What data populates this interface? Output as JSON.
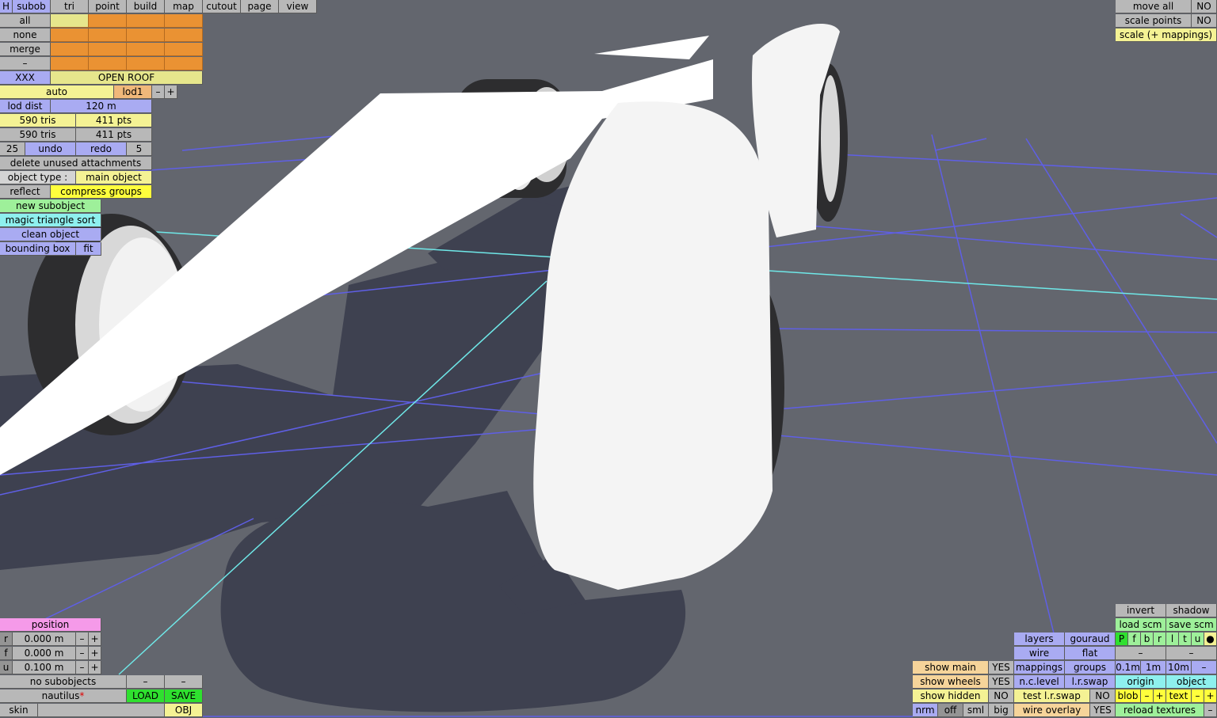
{
  "menu": {
    "h": "H",
    "tabs": [
      "subob",
      "tri",
      "point",
      "build",
      "map",
      "cutout",
      "page",
      "view"
    ]
  },
  "selection": {
    "all": "all",
    "none": "none",
    "merge": "merge",
    "minus": "–",
    "xxx": "XXX",
    "open_roof": "OPEN ROOF"
  },
  "lod": {
    "auto": "auto",
    "lod1": "lod1",
    "minus": "–",
    "plus": "+",
    "lod_dist_label": "lod dist",
    "lod_dist_value": "120 m"
  },
  "stats": {
    "tris1": "590 tris",
    "pts1": "411 pts",
    "tris2": "590 tris",
    "pts2": "411 pts"
  },
  "undo": {
    "count": "25",
    "undo": "undo",
    "redo": "redo",
    "redo_count": "5"
  },
  "actions": {
    "delete_unused": "delete unused attachments",
    "object_type_label": "object type :",
    "object_type_value": "main object",
    "reflect": "reflect",
    "compress_groups": "compress groups",
    "new_subobject": "new subobject",
    "magic_sort": "magic triangle sort",
    "clean_object": "clean object",
    "bounding_box": "bounding box",
    "fit": "fit"
  },
  "top_right": {
    "move_all": "move all",
    "move_all_val": "NO",
    "scale_points": "scale points",
    "scale_points_val": "NO",
    "scale_mappings": "scale (+ mappings)"
  },
  "position": {
    "title": "position",
    "rows": [
      {
        "axis": "r",
        "value": "0.000 m"
      },
      {
        "axis": "f",
        "value": "0.000 m"
      },
      {
        "axis": "u",
        "value": "0.100 m"
      }
    ],
    "minus": "–",
    "plus": "+"
  },
  "bottom_left": {
    "no_subobjects": "no subobjects",
    "dash": "–",
    "name": "nautilus",
    "star": "*",
    "load": "LOAD",
    "save": "SAVE",
    "skin": "skin",
    "obj": "OBJ"
  },
  "show": {
    "main": "show main",
    "main_val": "YES",
    "wheels": "show wheels",
    "wheels_val": "YES",
    "hidden": "show hidden",
    "hidden_val": "NO",
    "nrm": "nrm",
    "off": "off",
    "sml": "sml",
    "big": "big"
  },
  "view_opts": {
    "layers": "layers",
    "gouraud": "gouraud",
    "wire": "wire",
    "flat": "flat",
    "mappings": "mappings",
    "groups": "groups",
    "nc_level": "n.c.level",
    "lr_swap": "l.r.swap",
    "test_lr_swap": "test l.r.swap",
    "test_val": "NO",
    "wire_overlay": "wire overlay",
    "wire_overlay_val": "YES"
  },
  "right_tools": {
    "invert": "invert",
    "shadow": "shadow",
    "load_scm": "load scm",
    "save_scm": "save scm",
    "letters": [
      "P",
      "f",
      "b",
      "r",
      "l",
      "t",
      "u"
    ],
    "dot": "●",
    "dash": "–",
    "grid": [
      "0.1m",
      "1m",
      "10m"
    ],
    "origin": "origin",
    "object": "object",
    "blob": "blob",
    "text": "text",
    "minus": "–",
    "plus": "+",
    "reload_textures": "reload textures"
  }
}
